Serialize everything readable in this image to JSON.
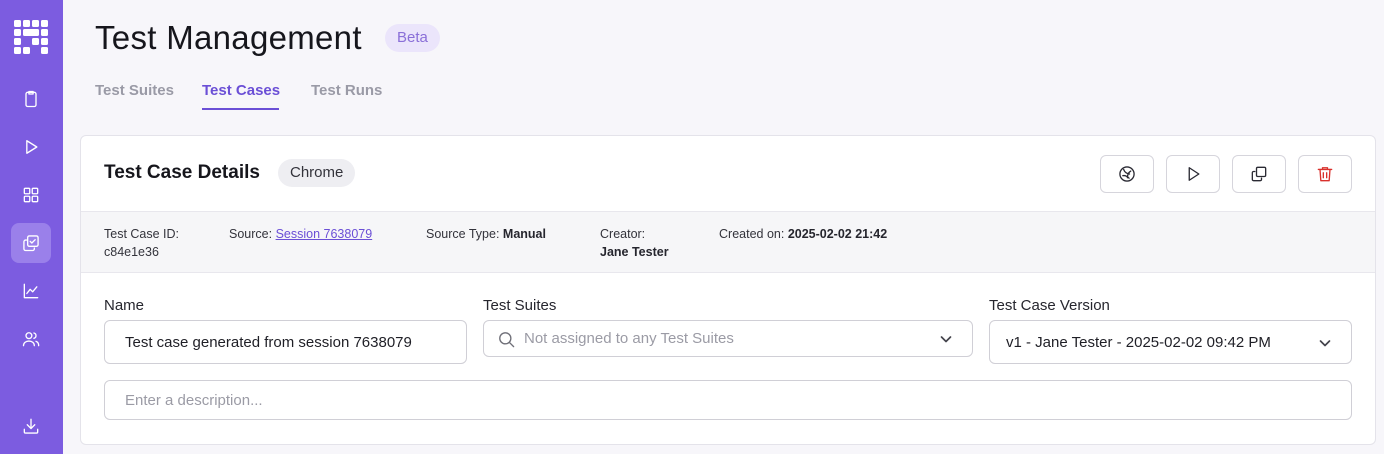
{
  "app": {
    "title": "Test Management",
    "badge": "Beta"
  },
  "sidebar": {
    "items": [
      {
        "icon": "clipboard-icon"
      },
      {
        "icon": "play-icon"
      },
      {
        "icon": "grid-icon"
      },
      {
        "icon": "test-cases-icon",
        "active": true
      },
      {
        "icon": "chart-icon"
      },
      {
        "icon": "users-icon"
      },
      {
        "icon": "download-icon"
      }
    ]
  },
  "tabs": [
    {
      "label": "Test Suites"
    },
    {
      "label": "Test Cases",
      "active": true
    },
    {
      "label": "Test Runs"
    }
  ],
  "card": {
    "title": "Test Case Details",
    "browser": "Chrome",
    "actions": [
      "rerun-icon",
      "play-icon",
      "duplicate-icon",
      "trash-icon"
    ]
  },
  "meta": {
    "id_label": "Test Case ID:",
    "id_value": "c84e1e36",
    "source_label": "Source:",
    "source_value": "Session 7638079",
    "source_type_label": "Source Type:",
    "source_type_value": "Manual",
    "creator_label": "Creator:",
    "creator_value": "Jane Tester",
    "created_label": "Created on:",
    "created_value": "2025-02-02 21:42"
  },
  "form": {
    "name_label": "Name",
    "name_value": "Test case generated from session 7638079",
    "suites_label": "Test Suites",
    "suites_placeholder": "Not assigned to any Test Suites",
    "version_label": "Test Case Version",
    "version_value": "v1 - Jane Tester - 2025-02-02 09:42 PM",
    "description_placeholder": "Enter a description..."
  },
  "colors": {
    "sidebar": "#7c5ce0",
    "accent": "#6b4fd6",
    "danger": "#d9302c"
  }
}
